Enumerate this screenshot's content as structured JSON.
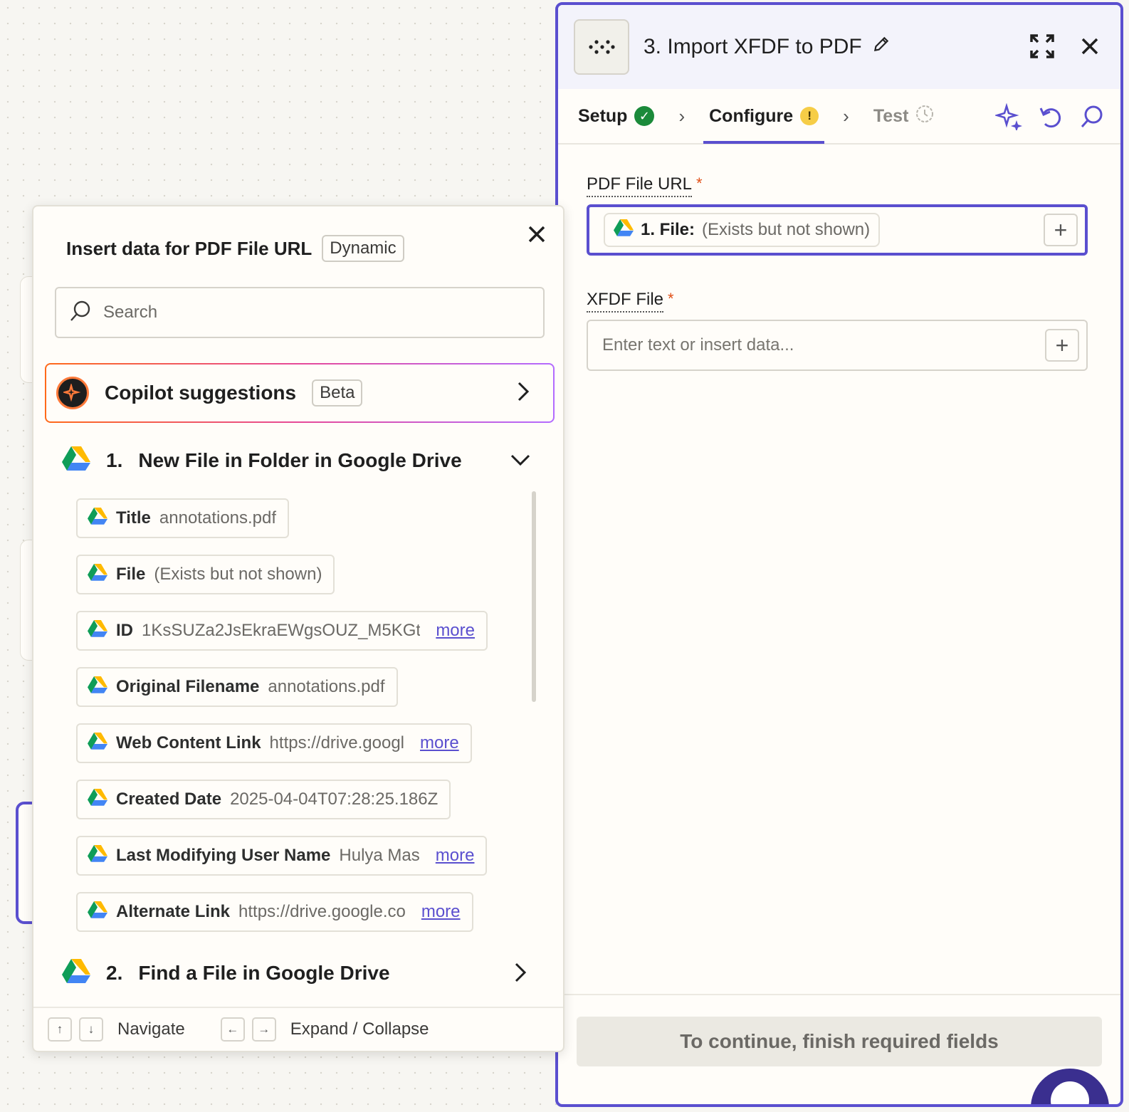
{
  "panel": {
    "title": "3. Import XFDF to PDF",
    "tabs": [
      {
        "label": "Setup",
        "status": "complete"
      },
      {
        "label": "Configure",
        "status": "warning"
      },
      {
        "label": "Test",
        "status": "pending"
      }
    ],
    "fields": [
      {
        "label": "PDF File URL",
        "required": "*",
        "pill_key": "1. File:",
        "pill_value": "(Exists but not shown)"
      },
      {
        "label": "XFDF File",
        "required": "*",
        "placeholder": "Enter text or insert data..."
      }
    ],
    "continue_label": "To continue, finish required fields"
  },
  "popover": {
    "title": "Insert data for PDF File URL",
    "tag": "Dynamic",
    "search_placeholder": "Search",
    "copilot": {
      "label": "Copilot suggestions",
      "tag": "Beta"
    },
    "groups": [
      {
        "number": "1.",
        "title": "New File in Folder in Google Drive",
        "expanded": true
      },
      {
        "number": "2.",
        "title": "Find a File in Google Drive",
        "expanded": false
      }
    ],
    "items": [
      {
        "key": "Title",
        "value": "annotations.pdf",
        "more": ""
      },
      {
        "key": "File",
        "value": "(Exists but not shown)",
        "more": ""
      },
      {
        "key": "ID",
        "value": "1KsSUZa2JsEkraEWgsOUZ_M5KGt",
        "more": "more"
      },
      {
        "key": "Original Filename",
        "value": "annotations.pdf",
        "more": ""
      },
      {
        "key": "Web Content Link",
        "value": "https://drive.googl",
        "more": "more"
      },
      {
        "key": "Created Date",
        "value": "2025-04-04T07:28:25.186Z",
        "more": ""
      },
      {
        "key": "Last Modifying User Name",
        "value": "Hulya Mas",
        "more": "more"
      },
      {
        "key": "Alternate Link",
        "value": "https://drive.google.co",
        "more": "more"
      }
    ],
    "footer": {
      "navigate": "Navigate",
      "expand_collapse": "Expand / Collapse",
      "keys": [
        "↑",
        "↓",
        "←",
        "→"
      ]
    }
  },
  "icons": {
    "app": "dots-logo-icon",
    "edit": "pencil-icon",
    "expand": "expand-icon",
    "close": "close-icon",
    "copilot": "sparkle-icon",
    "undo": "undo-icon",
    "search": "search-icon",
    "drive": "google-drive-icon"
  },
  "colors": {
    "accent": "#5a4fcf",
    "success": "#1b8a3a",
    "warning": "#f6cd47",
    "required": "#e14f17"
  }
}
